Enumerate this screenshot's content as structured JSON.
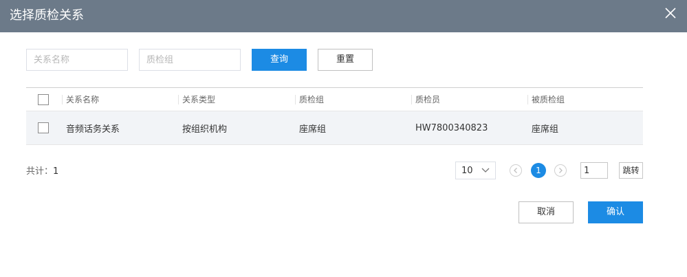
{
  "dialog": {
    "title": "选择质检关系"
  },
  "filters": {
    "name_placeholder": "关系名称",
    "group_placeholder": "质检组",
    "query_label": "查询",
    "reset_label": "重置"
  },
  "table": {
    "columns": [
      "关系名称",
      "关系类型",
      "质检组",
      "质检员",
      "被质检组"
    ],
    "rows": [
      [
        "音频话务关系",
        "按组织机构",
        "座席组",
        "HW7800340823",
        "座席组"
      ]
    ]
  },
  "pagination": {
    "total_label": "共计：",
    "total": "1",
    "page_size": "10",
    "current_page": "1",
    "jump_value": "1",
    "jump_label": "跳转"
  },
  "footer": {
    "cancel_label": "取消",
    "confirm_label": "确认"
  },
  "colors": {
    "header_bg": "#6c7a89",
    "primary": "#1c8be4",
    "row_bg": "#f2f4f7"
  }
}
